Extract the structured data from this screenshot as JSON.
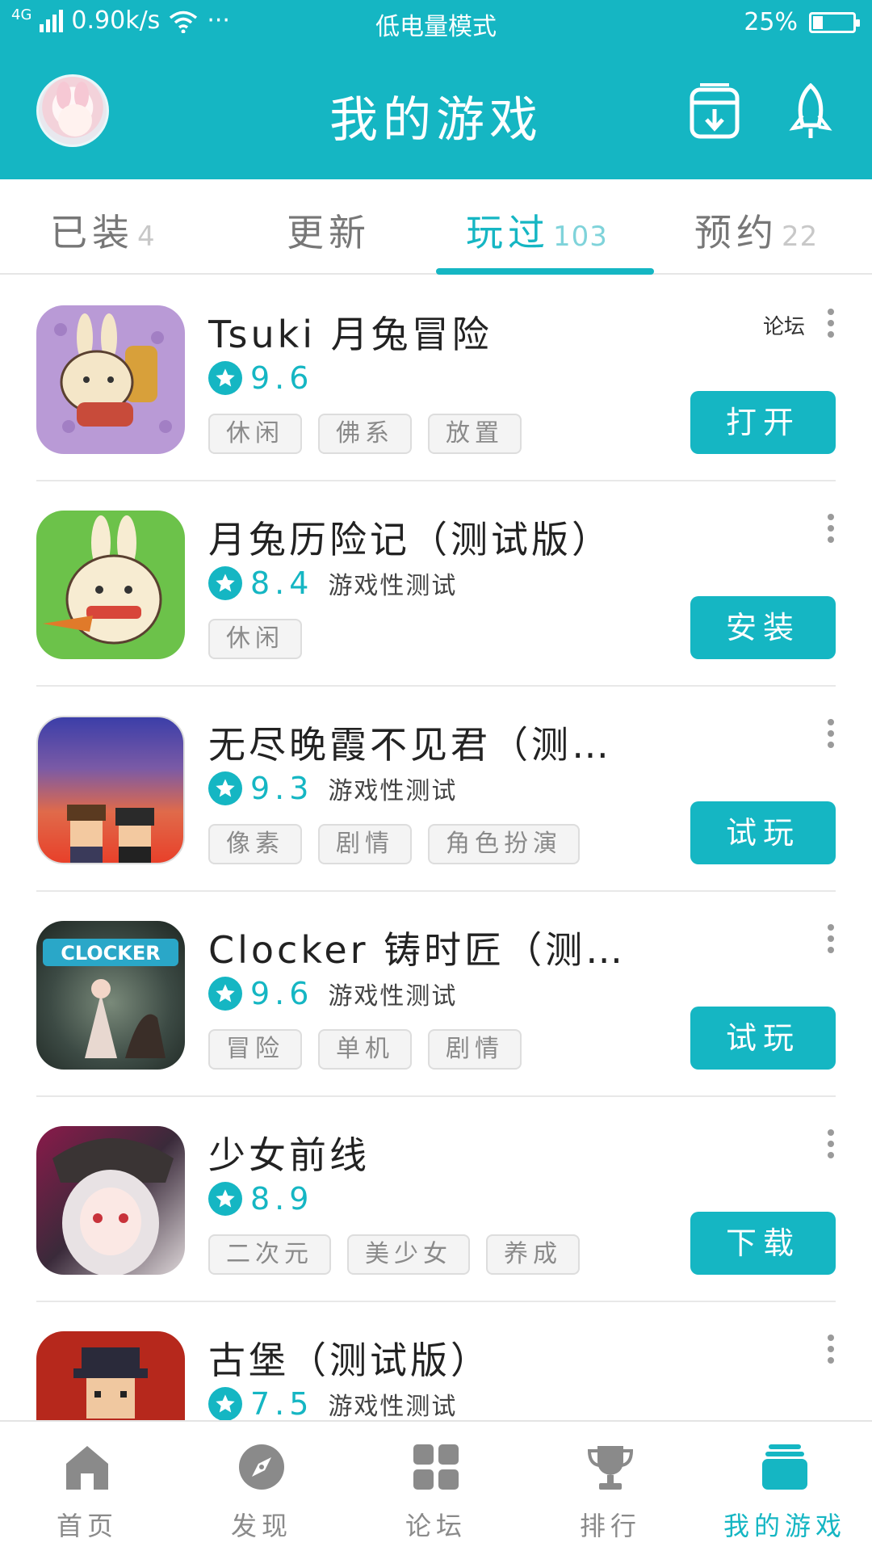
{
  "status_bar": {
    "network": "4G",
    "speed": "0.90k/s",
    "more": "···",
    "mode": "低电量模式",
    "battery": "25%"
  },
  "header": {
    "title": "我的游戏"
  },
  "tabs": [
    {
      "label": "已装",
      "count": "4"
    },
    {
      "label": "更新",
      "count": ""
    },
    {
      "label": "玩过",
      "count": "103"
    },
    {
      "label": "预约",
      "count": "22"
    }
  ],
  "active_tab": "玩过",
  "games": [
    {
      "title": "Tsuki 月兔冒险",
      "score": "9.6",
      "test_label": "",
      "tags": [
        "休闲",
        "佛系",
        "放置"
      ],
      "forum_label": "论坛",
      "action": "打开"
    },
    {
      "title": "月兔历险记（测试版）",
      "score": "8.4",
      "test_label": "游戏性测试",
      "tags": [
        "休闲"
      ],
      "forum_label": "",
      "action": "安装"
    },
    {
      "title": "无尽晚霞不见君（测…",
      "score": "9.3",
      "test_label": "游戏性测试",
      "tags": [
        "像素",
        "剧情",
        "角色扮演"
      ],
      "forum_label": "",
      "action": "试玩"
    },
    {
      "title": "Clocker 铸时匠（测…",
      "score": "9.6",
      "test_label": "游戏性测试",
      "tags": [
        "冒险",
        "单机",
        "剧情"
      ],
      "forum_label": "",
      "action": "试玩"
    },
    {
      "title": "少女前线",
      "score": "8.9",
      "test_label": "",
      "tags": [
        "二次元",
        "美少女",
        "养成"
      ],
      "forum_label": "",
      "action": "下载"
    },
    {
      "title": "古堡（测试版）",
      "score": "7.5",
      "test_label": "游戏性测试",
      "tags": [],
      "forum_label": "",
      "action": ""
    }
  ],
  "bottom_nav": [
    {
      "label": "首页",
      "icon": "home-icon"
    },
    {
      "label": "发现",
      "icon": "compass-icon"
    },
    {
      "label": "论坛",
      "icon": "grid-icon"
    },
    {
      "label": "排行",
      "icon": "trophy-icon"
    },
    {
      "label": "我的游戏",
      "icon": "stack-icon"
    }
  ],
  "colors": {
    "accent": "#15b6c3",
    "tag_bg": "#f4f4f4",
    "nav_inactive": "#8a8a8a"
  }
}
